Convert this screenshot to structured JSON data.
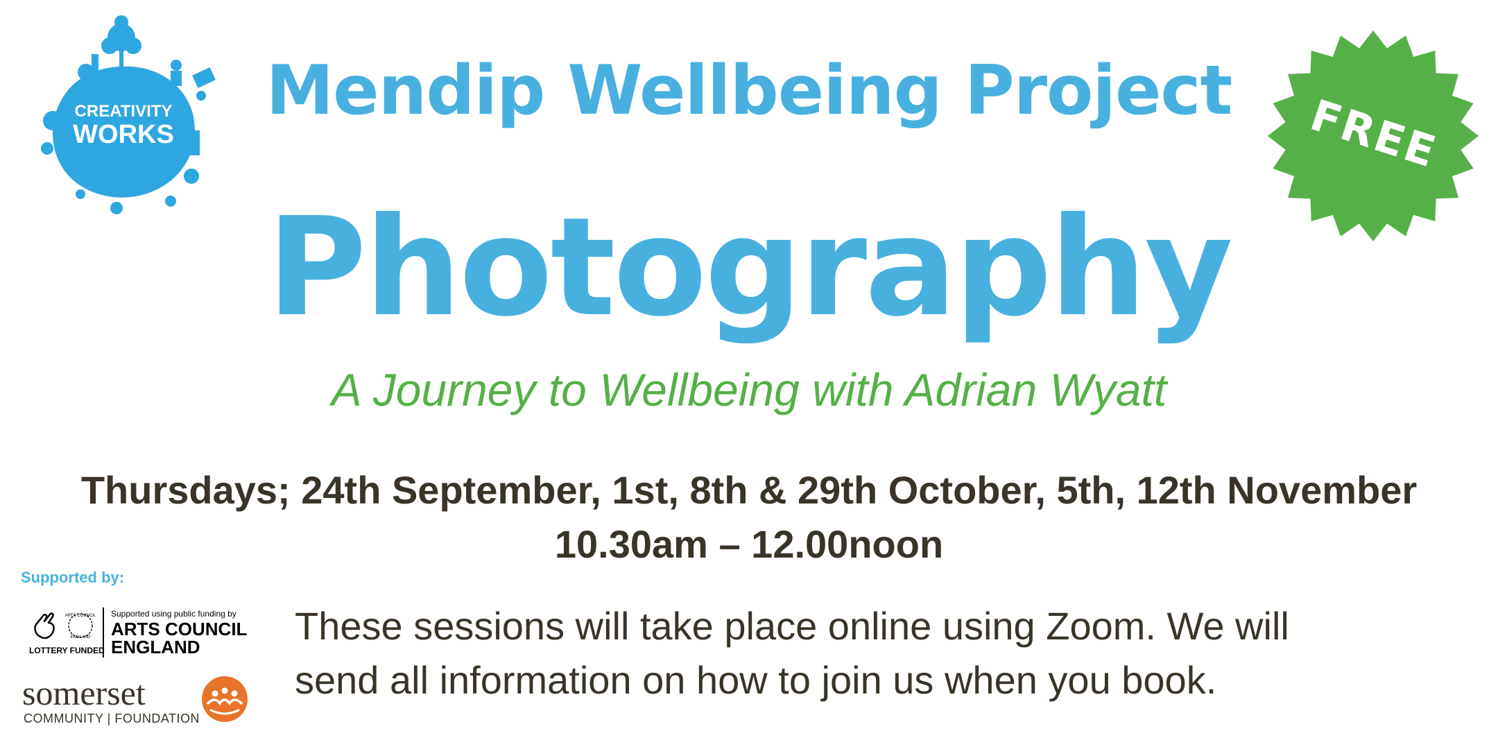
{
  "logo": {
    "line1": "CREATIVITY",
    "line2": "WORKS"
  },
  "badge": {
    "label": "FREE"
  },
  "project_title": "Mendip Wellbeing Project",
  "main_title": "Photography",
  "subtitle": "A Journey to Wellbeing with Adrian Wyatt",
  "dates": "Thursdays; 24th September, 1st, 8th & 29th October, 5th, 12th November",
  "times": "10.30am – 12.00noon",
  "supported_by": "Supported by:",
  "info_line1": "These sessions will take place online using Zoom. We will",
  "info_line2": "send all information on how to join us when you book.",
  "arts_council": {
    "lottery_label": "LOTTERY FUNDED",
    "circle_top": "ARTS COUNCIL",
    "circle_bottom": "ENGLAND",
    "small": "Supported using public funding by",
    "big1": "ARTS COUNCIL",
    "big2": "ENGLAND"
  },
  "somerset": {
    "word": "somerset",
    "sub": "COMMUNITY | FOUNDATION"
  },
  "colors": {
    "blue": "#48b0df",
    "green": "#55b047",
    "dark": "#3a3428",
    "orange": "#e8742a"
  }
}
